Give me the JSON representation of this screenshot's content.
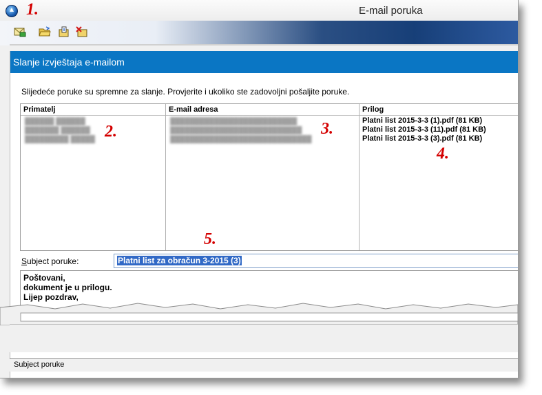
{
  "window": {
    "title": "E-mail poruka"
  },
  "toolbar": {
    "buttons": [
      {
        "icon": "send-mail-icon"
      },
      {
        "icon": "open-folder-icon"
      },
      {
        "icon": "attach-file-icon"
      },
      {
        "icon": "delete-attachment-icon"
      }
    ]
  },
  "header": {
    "title": "Slanje izvještaja e-mailom"
  },
  "intro_text": "Slijedeće poruke su spremne za slanje. Provjerite i ukoliko ste zadovoljni pošaljite poruke.",
  "columns": {
    "recipient": "Primatelj",
    "email": "E-mail adresa",
    "attachment": "Prilog"
  },
  "attachments": [
    "Platni list 2015-3-3 (1).pdf (81 KB)",
    "Platni list 2015-3-3 (11).pdf (81 KB)",
    "Platni list 2015-3-3 (3).pdf (81 KB)"
  ],
  "subject": {
    "label": "Subject poruke:",
    "value": "Platni list za obračun 3-2015 (3)"
  },
  "body_lines": [
    "Poštovani,",
    "dokument je u prilogu.",
    "Lijep pozdrav,"
  ],
  "markers": [
    "1.",
    "2.",
    "3.",
    "4.",
    "5."
  ],
  "status": "Subject poruke",
  "colors": {
    "header_band": "#0a76c4",
    "marker": "#d40000",
    "selection": "#3169c6"
  }
}
